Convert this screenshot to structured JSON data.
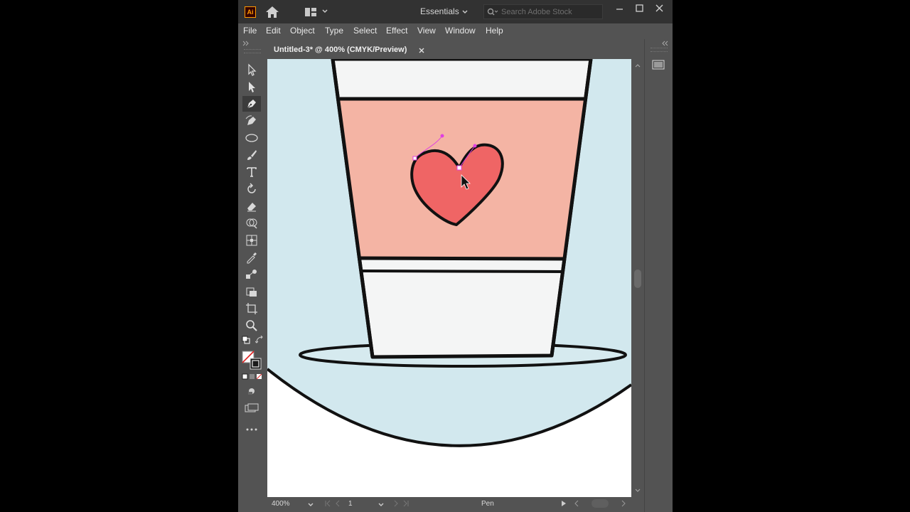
{
  "app": {
    "logo": "Ai",
    "workspace": "Essentials",
    "search_placeholder": "Search Adobe Stock"
  },
  "menu": [
    "File",
    "Edit",
    "Object",
    "Type",
    "Select",
    "Effect",
    "View",
    "Window",
    "Help"
  ],
  "document": {
    "tab_title": "Untitled-3* @ 400% (CMYK/Preview)"
  },
  "tools": [
    "selection-tool",
    "direct-selection-tool",
    "pen-tool",
    "curvature-tool",
    "ellipse-tool",
    "paintbrush-tool",
    "type-tool",
    "rotate-tool",
    "eraser-tool",
    "shape-builder-tool",
    "free-transform-tool",
    "eyedropper-tool",
    "blend-tool",
    "symbol-sprayer-tool",
    "artboard-tool",
    "zoom-tool"
  ],
  "active_tool": "pen-tool",
  "status": {
    "zoom": "400%",
    "artboard": "1",
    "current_tool": "Pen"
  },
  "colors": {
    "accent_logo": "#ff9a00",
    "canvas_blue": "#d2e8ee",
    "label_pink": "#f4b4a4",
    "heart_red": "#ef6565",
    "anchor_magenta": "#e040e0",
    "cup_white": "#f4f5f5"
  }
}
